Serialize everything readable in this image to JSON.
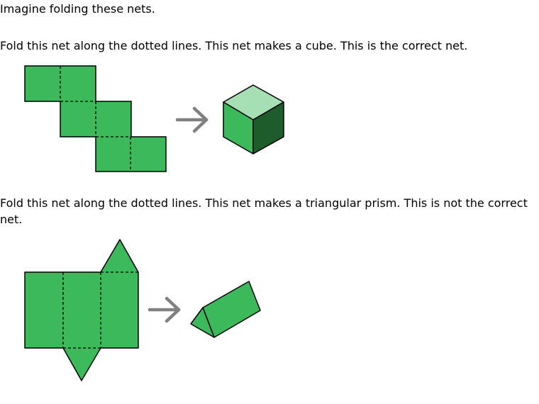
{
  "intro": "Imagine folding these nets.",
  "example1": {
    "text": "Fold this net along the dotted lines. This net makes a cube. This is the correct net.",
    "net_icon": "cube-net-icon",
    "arrow_icon": "right-arrow-icon",
    "result_icon": "cube-icon"
  },
  "example2": {
    "text": "Fold this net along the dotted lines. This net makes a triangular prism. This is not the correct net.",
    "net_icon": "triangular-prism-net-icon",
    "arrow_icon": "right-arrow-icon",
    "result_icon": "triangular-prism-icon"
  },
  "colors": {
    "face": "#3cb95a",
    "face_light": "#a5dfb3",
    "face_dark": "#1e5c2c",
    "arrow": "#808080",
    "outline": "#000000"
  }
}
